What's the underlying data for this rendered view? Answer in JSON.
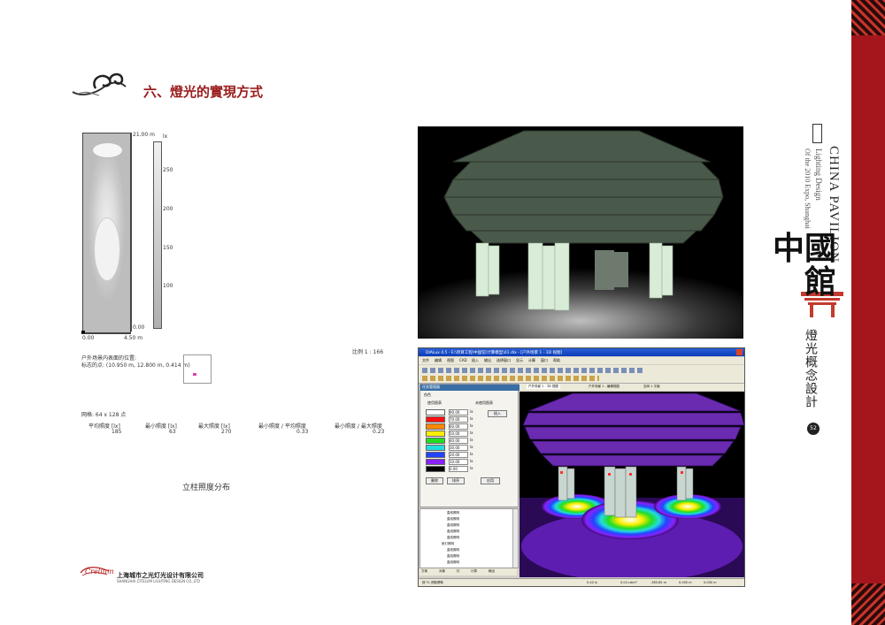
{
  "heading": "六、燈光的實現方式",
  "company": {
    "logo_text": "Crelium",
    "name_cn": "上海城市之光灯光设计有限公司",
    "name_en": "SHANGHAI CITELUM LIGHTING DESIGN CO.,LTD"
  },
  "right_panel": {
    "title": "CHINA PAVILION",
    "subtitle1": "Lighting Design",
    "subtitle2": "Of the 2010 Expo, Shanghai",
    "chinese_title": "中國館",
    "concept": "燈光概念設計",
    "page_num": "52"
  },
  "study": {
    "top_dim": "21.00 m",
    "bottom_dim": "0.00",
    "left_label": "0.00",
    "width_label": "4.50 m",
    "scale_unit": "lx",
    "scale_ticks": [
      "250",
      "200",
      "150",
      "100"
    ],
    "scale_ratio": "比例 1 : 166",
    "position_line1": "户外场景内表面的位置:",
    "position_line2": "标志的点: (10.950 m, 12.800 m, 0.414 m)",
    "grid": "网格: 64 x 128 点",
    "stats": {
      "headers": [
        "平均照度 [lx]",
        "最小照度 [lx]",
        "最大照度 [lx]",
        "最小照度 / 平均照度",
        "最小照度 / 最大照度"
      ],
      "values": [
        "185",
        "63",
        "270",
        "0.33",
        "0.23"
      ]
    },
    "caption": "立柱照度分布"
  },
  "dialux": {
    "title": "DIALux 4.5 - E:\\项目工程\\中国馆\\计算模型\\01.dlx - [户外场景 1 - 3D 视图]",
    "menu": [
      "文件",
      "编辑",
      "视图",
      "CAD",
      "插入",
      "输出",
      "选择窗口",
      "显示",
      "计算",
      "窗口",
      "帮助"
    ],
    "panel_title": "任务管理器",
    "panel_tab": "伪色",
    "radio1": "使用图表",
    "radio2": "未使用图表",
    "values": [
      "90.00",
      "70.00",
      "60.00",
      "50.00",
      "40.00",
      "30.00",
      "20.00",
      "10.00",
      "0.00"
    ],
    "unit": "lx",
    "btn_insert": "插入",
    "btn_delete": "删除",
    "btn_sort": "排序",
    "btn_apply": "应用",
    "view_tabs": [
      "户外场景 1 - 3D 视图",
      "户外场景 1 - 编辑视图",
      "空间 1 平面"
    ],
    "tree_items": [
      "直线照明",
      "直线照明",
      "直线照明",
      "直线照明",
      "直线照明",
      "射灯照明",
      "直线照明",
      "直线照明",
      "直线照明"
    ],
    "bottom_tabs": [
      "方案",
      "对象",
      "灯",
      "计算",
      "输出"
    ],
    "status_left": "按 F1 获取帮助",
    "status_values": [
      "0.40 lx",
      "0.04 cd/m²",
      "-385.65 m",
      "0.000 m",
      "0.000 m"
    ],
    "colors": [
      "#ffffff",
      "#ff1010",
      "#ff8800",
      "#ffee00",
      "#22dd22",
      "#22dddd",
      "#2244ff",
      "#8822ff",
      "#000000"
    ]
  }
}
